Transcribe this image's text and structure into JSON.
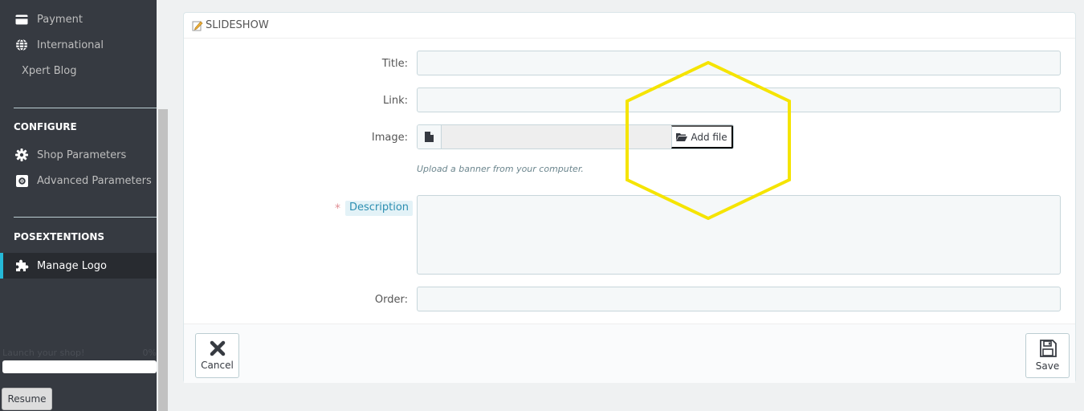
{
  "sidebar": {
    "items": [
      {
        "label": "Payment",
        "icon": "credit-card-icon"
      },
      {
        "label": "International",
        "icon": "globe-icon"
      },
      {
        "label": "Xpert Blog",
        "icon": ""
      }
    ],
    "configure": {
      "heading": "CONFIGURE",
      "items": [
        {
          "label": "Shop Parameters",
          "icon": "gear-icon"
        },
        {
          "label": "Advanced Parameters",
          "icon": "settings-box-icon"
        }
      ]
    },
    "posextentions": {
      "heading": "POSEXTENTIONS",
      "items": [
        {
          "label": "Manage Logo",
          "icon": "puzzle-icon",
          "active": true
        }
      ]
    },
    "launch": {
      "label": "Launch your shop!",
      "percent": "0%",
      "progress": 0
    },
    "resume_label": "Resume"
  },
  "panel": {
    "heading": "SLIDESHOW",
    "fields": {
      "title_label": "Title:",
      "link_label": "Link:",
      "image_label": "Image:",
      "add_file_label": "Add file",
      "image_help": "Upload a banner from your computer.",
      "required_mark": "*",
      "description_label": "Description",
      "order_label": "Order:"
    },
    "footer": {
      "cancel_label": "Cancel",
      "save_label": "Save"
    }
  },
  "colors": {
    "sidebar_bg": "#363a41",
    "active_accent": "#25b9d7",
    "highlight_shape": "#f5e400"
  }
}
